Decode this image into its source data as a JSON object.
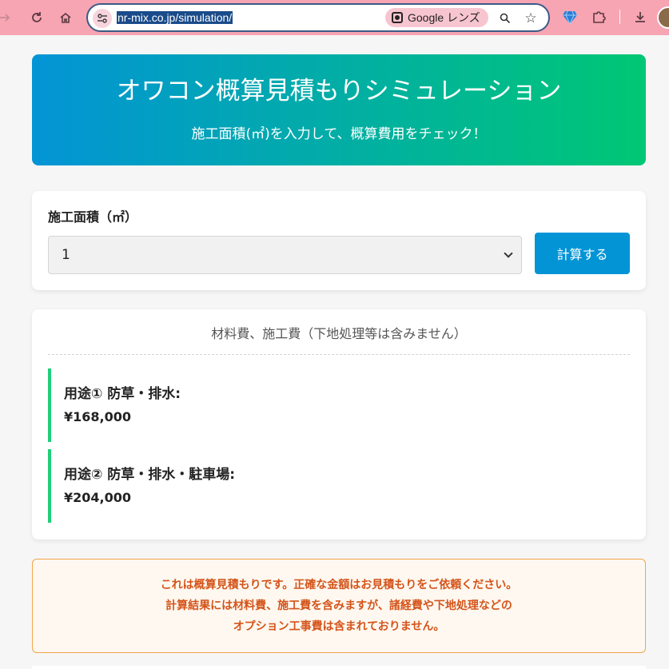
{
  "browser": {
    "url": "nr-mix.co.jp/simulation/",
    "lens_label": "Google レンズ",
    "icons": {
      "forward": "arrow-right-icon",
      "reload": "reload-icon",
      "home": "home-icon",
      "site_info": "tune-icon",
      "zoom": "zoom-icon",
      "bookmark": "star-icon",
      "extension": "gem-icon",
      "extensions": "puzzle-icon",
      "download": "download-icon"
    }
  },
  "hero": {
    "title": "オワコン概算見積もりシミュレーション",
    "subtitle": "施工面積(㎡)を入力して、概算費用をチェック！"
  },
  "form": {
    "label": "施工面積（㎡）",
    "selected_value": "1",
    "button_label": "計算する"
  },
  "results": {
    "header": "材料費、施工費（下地処理等は含みません）",
    "items": [
      {
        "label": "用途① 防草・排水:",
        "price": "¥168,000"
      },
      {
        "label": "用途② 防草・排水・駐車場:",
        "price": "¥204,000"
      }
    ]
  },
  "notice": {
    "lines": [
      "これは概算見積もりです。正確な金額はお見積もりをご依頼ください。",
      "計算結果には材料費、施工費を含みますが、諸経費や下地処理などの",
      "オプション工事費は含まれておりません。"
    ]
  },
  "colors": {
    "hero_start": "#0394d6",
    "hero_end": "#00c774",
    "button": "#0394d6",
    "accent_bar": "#1fcf7a",
    "notice_text": "#d4541a",
    "notice_border": "#f1a54b"
  }
}
